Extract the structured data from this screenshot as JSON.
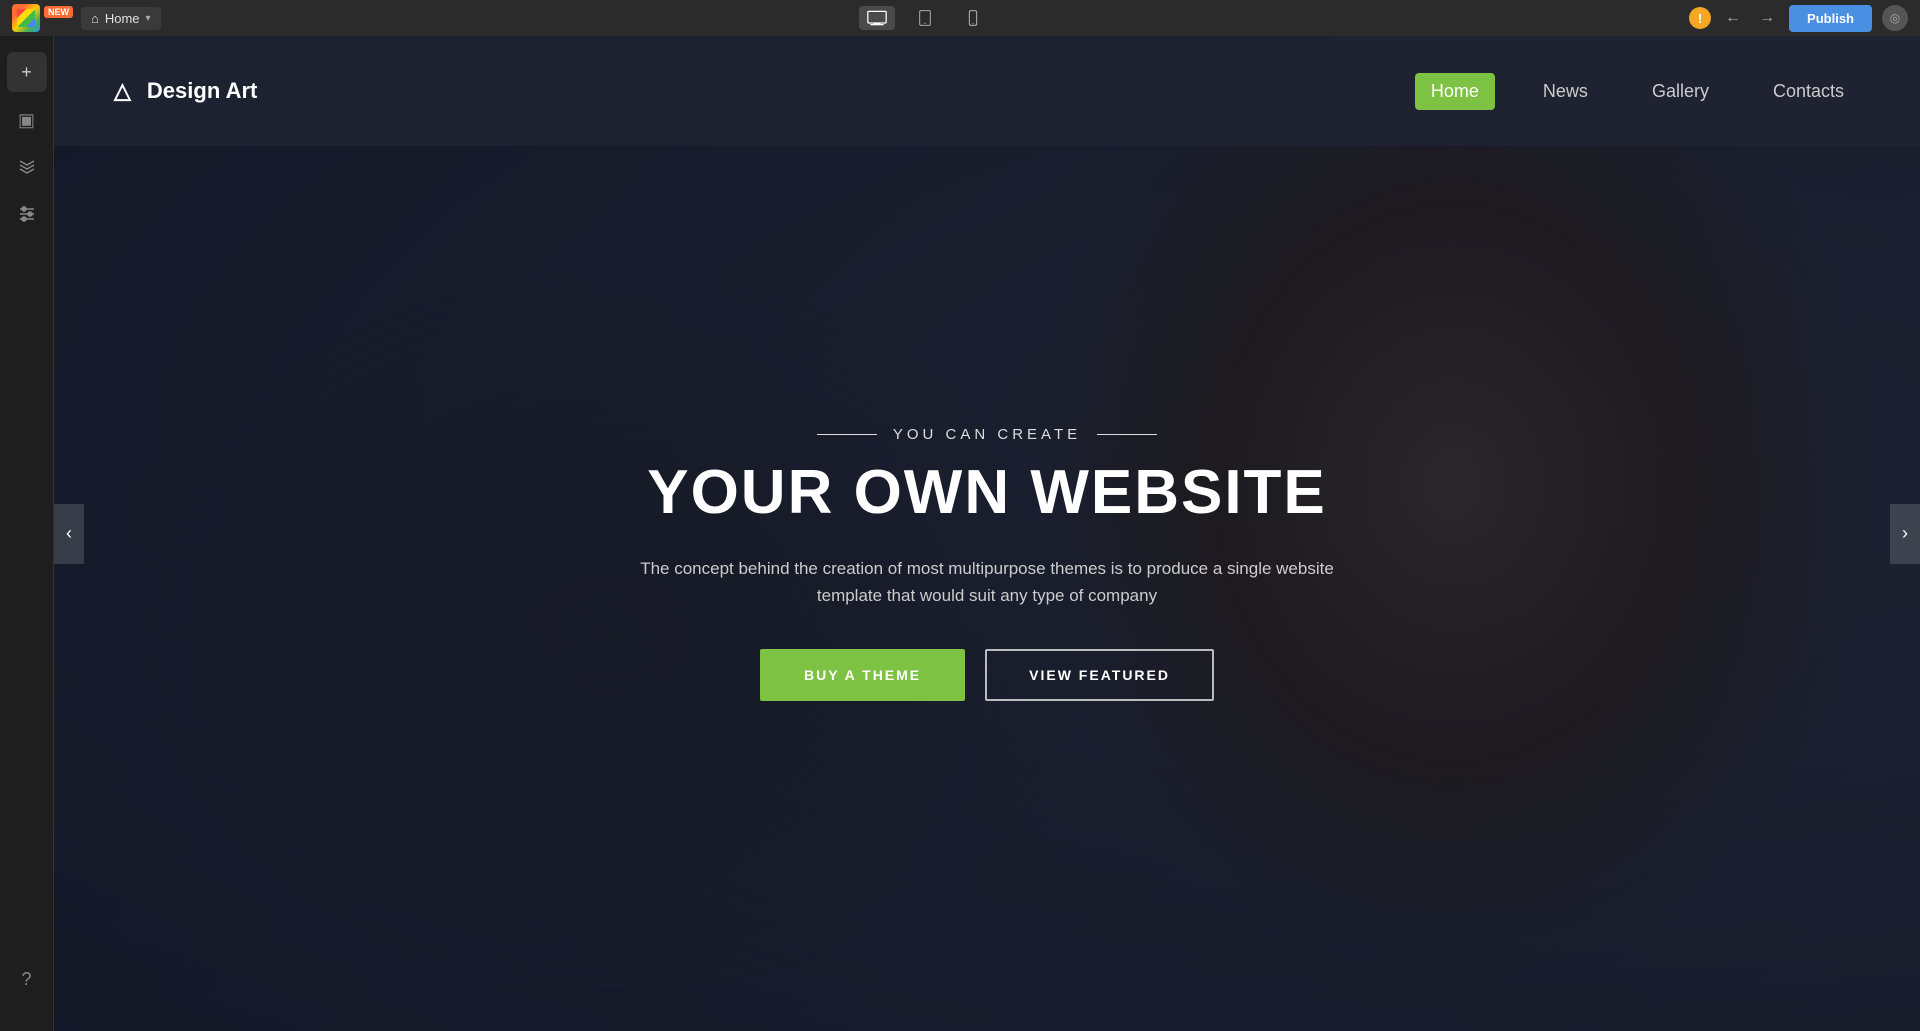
{
  "osbar": {
    "logo_label": "App Logo",
    "badge": "NEW",
    "home_tab": "Home",
    "chevron": "▾",
    "devices": [
      {
        "id": "desktop",
        "label": "Desktop",
        "active": true
      },
      {
        "id": "tablet",
        "label": "Tablet",
        "active": false
      },
      {
        "id": "mobile",
        "label": "Mobile",
        "active": false
      }
    ],
    "warning_symbol": "!",
    "undo_symbol": "←",
    "redo_symbol": "→",
    "publish_label": "Publish"
  },
  "sidebar": {
    "icons": [
      {
        "id": "add",
        "symbol": "+",
        "label": "Add Element"
      },
      {
        "id": "media",
        "symbol": "▣",
        "label": "Media"
      },
      {
        "id": "layers",
        "symbol": "⊞",
        "label": "Layers"
      },
      {
        "id": "settings",
        "symbol": "⚙",
        "label": "Settings"
      }
    ],
    "bottom_icons": [
      {
        "id": "help",
        "symbol": "?",
        "label": "Help"
      }
    ]
  },
  "website": {
    "navbar": {
      "brand_icon": "△",
      "brand_name": "Design Art",
      "nav_items": [
        {
          "id": "home",
          "label": "Home",
          "active": true
        },
        {
          "id": "news",
          "label": "News",
          "active": false
        },
        {
          "id": "gallery",
          "label": "Gallery",
          "active": false
        },
        {
          "id": "contacts",
          "label": "Contacts",
          "active": false
        }
      ]
    },
    "hero": {
      "subtitle": "YOU CAN CREATE",
      "title": "YOUR OWN WEBSITE",
      "description": "The concept behind the creation of most multipurpose themes is to produce a\nsingle website template that would suit any type of company",
      "btn_primary": "BUY A THEME",
      "btn_secondary": "VIEW FEATURED"
    }
  },
  "colors": {
    "green_accent": "#7dc242",
    "blue_accent": "#4a90e2",
    "sidebar_bg": "#1e1e1e",
    "navbar_bg": "rgba(30,35,50,0.92)",
    "os_bar_bg": "#2b2b2b"
  }
}
